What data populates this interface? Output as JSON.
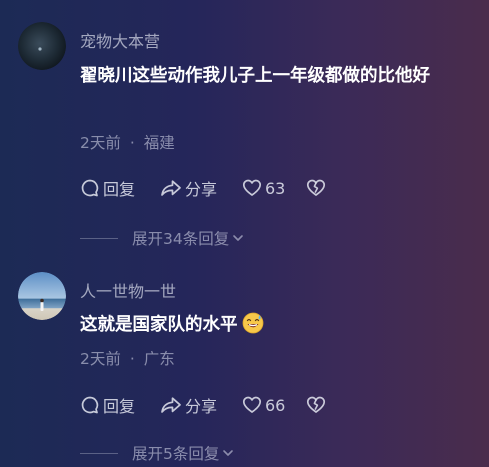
{
  "comments": [
    {
      "username": "宠物大本营",
      "text": "翟晓川这些动作我儿子上一年级都做的比他好",
      "time": "2天前",
      "separator": "·",
      "location": "福建",
      "reply_label": "回复",
      "share_label": "分享",
      "like_count": "63",
      "expand_label": "展开34条回复"
    },
    {
      "username": "人一世物一世",
      "text": "这就是国家队的水平",
      "emoji": "grinning-sweat-face",
      "time": "2天前",
      "separator": "·",
      "location": "广东",
      "reply_label": "回复",
      "share_label": "分享",
      "like_count": "66",
      "expand_label": "展开5条回复"
    }
  ]
}
